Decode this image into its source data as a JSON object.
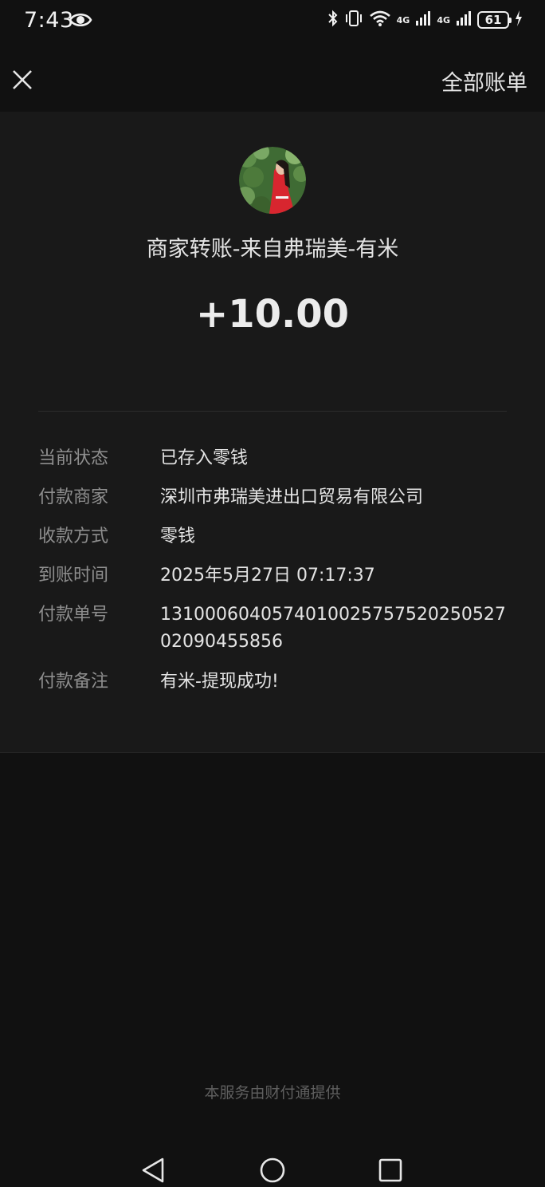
{
  "status_bar": {
    "time": "7:43",
    "network_1": "4G",
    "network_2": "4G",
    "battery": "61"
  },
  "header": {
    "all_bills": "全部账单"
  },
  "transaction": {
    "title": "商家转账-来自弗瑞美-有米",
    "amount": "+10.00"
  },
  "details": {
    "status_label": "当前状态",
    "status_value": "已存入零钱",
    "merchant_label": "付款商家",
    "merchant_value": "深圳市弗瑞美进出口贸易有限公司",
    "method_label": "收款方式",
    "method_value": "零钱",
    "time_label": "到账时间",
    "time_value": "2025年5月27日 07:17:37",
    "order_label": "付款单号",
    "order_value": "131000604057401002575752025052702090455856",
    "remark_label": "付款备注",
    "remark_value": "有米-提现成功!"
  },
  "footer": {
    "provider": "本服务由财付通提供"
  },
  "colors": {
    "background": "#111111",
    "card": "#191919",
    "label": "#8e8e8e",
    "value": "#e4e4e4"
  }
}
